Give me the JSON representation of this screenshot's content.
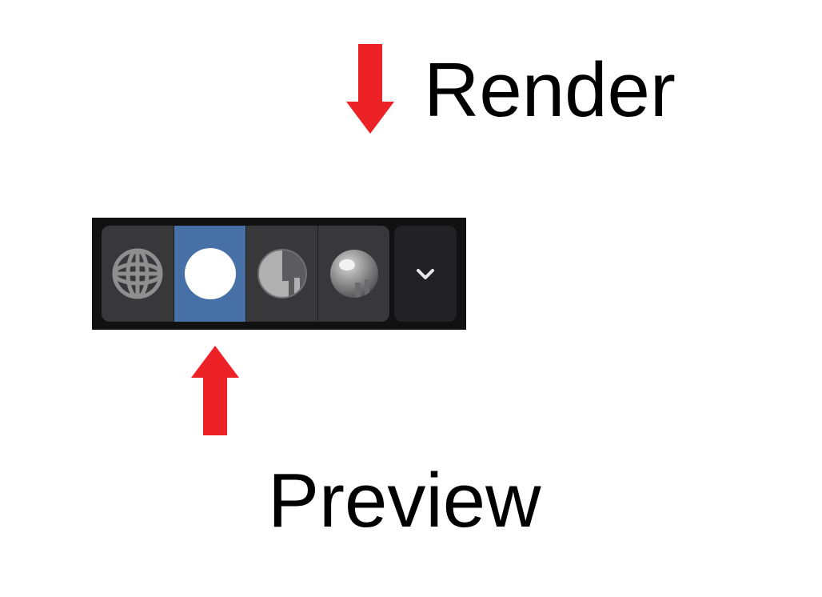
{
  "annotations": {
    "render_label": "Render",
    "preview_label": "Preview"
  },
  "toolbar": {
    "shading_modes": [
      {
        "name": "wireframe",
        "selected": false
      },
      {
        "name": "solid",
        "selected": true
      },
      {
        "name": "material-preview",
        "selected": false
      },
      {
        "name": "rendered",
        "selected": false
      }
    ],
    "dropdown_icon": "chevron-down"
  },
  "colors": {
    "arrow": "#ec2227",
    "toolbar_bg": "#111111",
    "button_bg": "#38383a",
    "button_selected": "#4770a7",
    "dropdown_bg": "#222224",
    "icon": "#9a9a9a",
    "icon_selected": "#ffffff"
  }
}
